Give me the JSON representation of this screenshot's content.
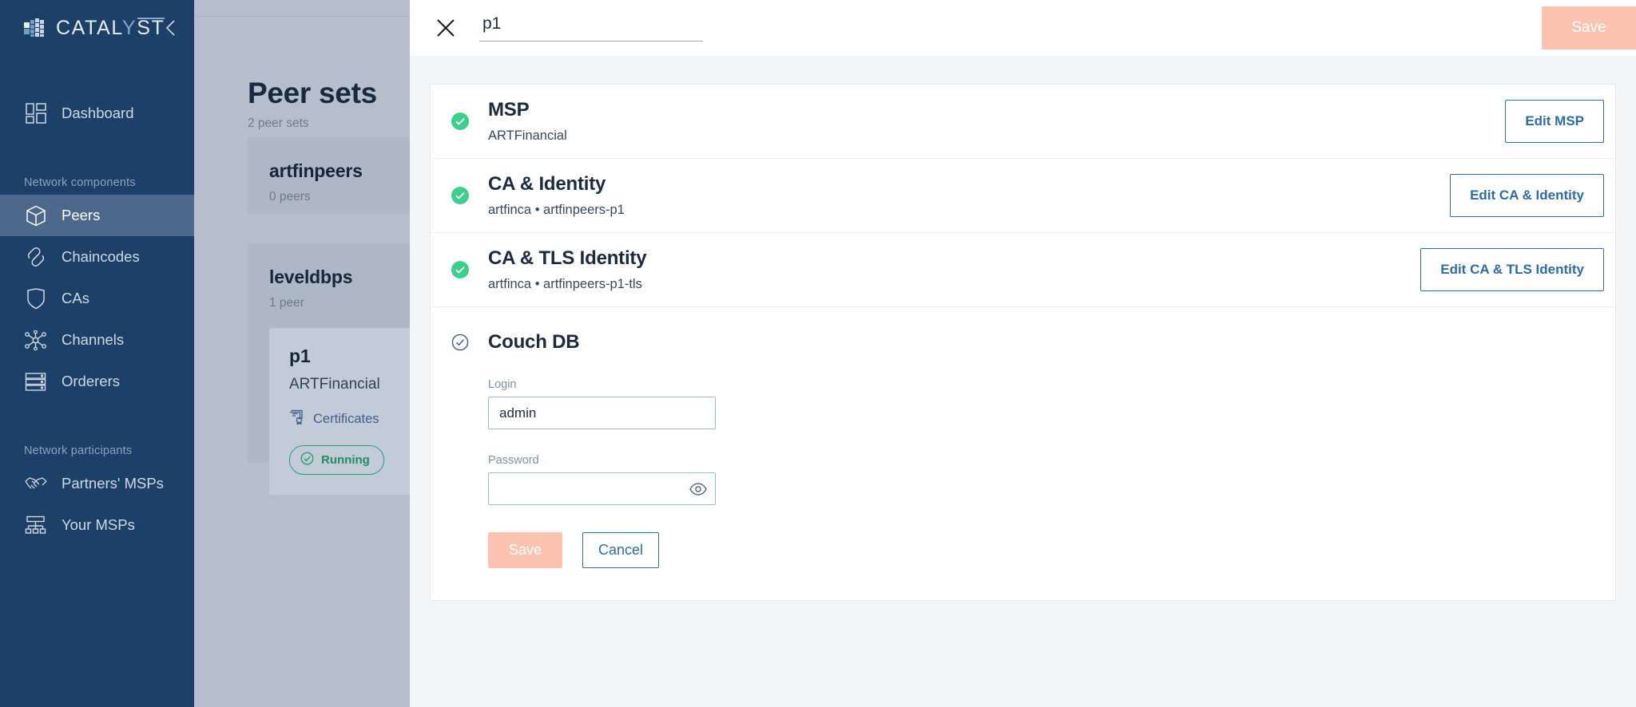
{
  "brand": {
    "name_main": "CATAL",
    "name_accent": "Y",
    "name_tail": "ST",
    "logo_icon": "cube-grid-logo-icon",
    "collapse_icon": "chevron-left-icon"
  },
  "sidebar": {
    "items": [
      {
        "label": "Dashboard",
        "icon": "dashboard-grid-icon",
        "active": false
      },
      {
        "label": "Peers",
        "icon": "cube-icon",
        "active": true
      },
      {
        "label": "Chaincodes",
        "icon": "link-chain-icon",
        "active": false
      },
      {
        "label": "CAs",
        "icon": "shield-icon",
        "active": false
      },
      {
        "label": "Channels",
        "icon": "network-nodes-icon",
        "active": false
      },
      {
        "label": "Orderers",
        "icon": "server-stack-icon",
        "active": false
      },
      {
        "label": "Partners' MSPs",
        "icon": "handshake-icon",
        "active": false
      },
      {
        "label": "Your MSPs",
        "icon": "org-tree-icon",
        "active": false
      }
    ],
    "section_network_components": "Network components",
    "section_network_participants": "Network participants"
  },
  "peer_sets_panel": {
    "title": "Peer sets",
    "subtitle": "2 peer sets",
    "sets": [
      {
        "name": "artfinpeers",
        "count": "0 peers"
      },
      {
        "name": "leveldbps",
        "count": "1 peer"
      }
    ],
    "peer": {
      "name": "p1",
      "org": "ARTFinancial",
      "certificates_label": "Certificates",
      "certificates_icon": "certificate-icon",
      "status_label": "Running",
      "status_icon": "check-circle-icon",
      "status_color": "#23a06e"
    }
  },
  "modal": {
    "close_icon": "close-x-icon",
    "title_value": "p1",
    "title_placeholder": "Name",
    "save_top_label": "Save",
    "rows": [
      {
        "title": "MSP",
        "subtitle": "ARTFinancial",
        "status_icon": "check-circle-filled-icon",
        "button": "Edit MSP"
      },
      {
        "title": "CA & Identity",
        "subtitle": "artfinca • artfinpeers-p1",
        "status_icon": "check-circle-filled-icon",
        "button": "Edit CA & Identity"
      },
      {
        "title": "CA & TLS Identity",
        "subtitle": "artfinca • artfinpeers-p1-tls",
        "status_icon": "check-circle-filled-icon",
        "button": "Edit CA & TLS Identity"
      }
    ],
    "couch": {
      "title": "Couch DB",
      "status_icon": "check-circle-outline-icon",
      "login_label": "Login",
      "login_value": "admin",
      "login_placeholder": "",
      "password_label": "Password",
      "password_value": "",
      "password_placeholder": "",
      "eye_icon": "eye-icon",
      "save_label": "Save",
      "cancel_label": "Cancel"
    }
  },
  "colors": {
    "sidebar_bg": "#1d4068",
    "sidebar_active": "#4c688a",
    "panel_bg": "#b6bece",
    "accent_blue": "#2e6ca3",
    "save_disabled": "#fcc3b0",
    "status_green": "#3ecf8e"
  }
}
